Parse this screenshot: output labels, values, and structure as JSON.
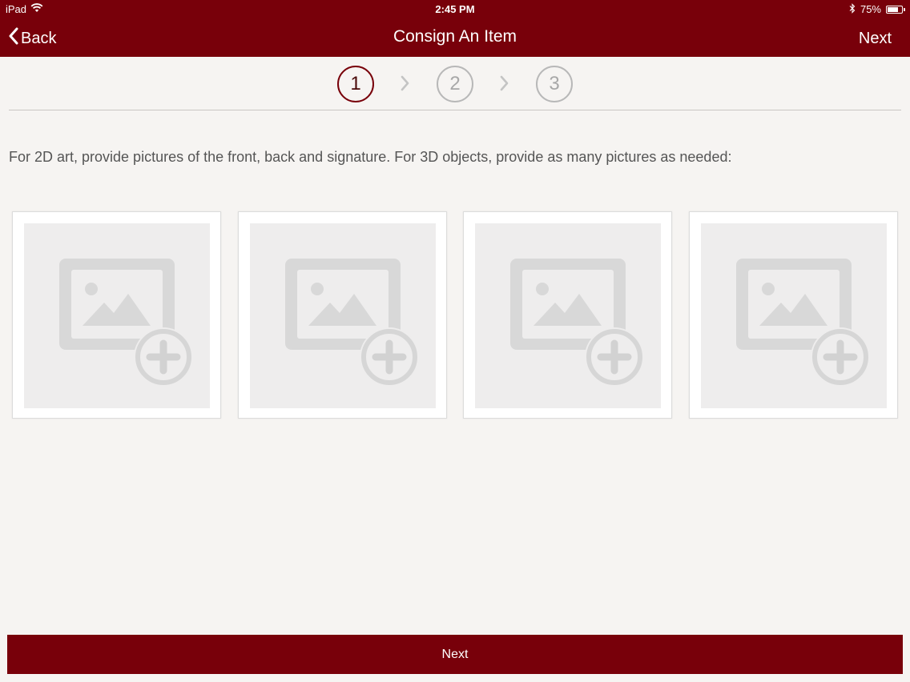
{
  "status_bar": {
    "device": "iPad",
    "time": "2:45 PM",
    "battery": "75%",
    "battery_level": 0.75,
    "icons": [
      "wifi-icon",
      "bluetooth-icon",
      "battery-icon"
    ]
  },
  "nav": {
    "back_label": "Back",
    "title": "Consign An Item",
    "next_label": "Next"
  },
  "steps": [
    {
      "label": "1",
      "active": true
    },
    {
      "label": "2",
      "active": false
    },
    {
      "label": "3",
      "active": false
    }
  ],
  "instruction": "For 2D art, provide pictures of the front, back and signature.  For 3D objects, provide as many pictures as needed:",
  "photo_slots": [
    {
      "icon": "add-photo-icon"
    },
    {
      "icon": "add-photo-icon"
    },
    {
      "icon": "add-photo-icon"
    },
    {
      "icon": "add-photo-icon"
    }
  ],
  "footer": {
    "next_label": "Next"
  },
  "colors": {
    "brand": "#78000a",
    "background": "#f6f4f2",
    "placeholder": "#eeeded",
    "icon_gray": "#d8d8d8"
  }
}
